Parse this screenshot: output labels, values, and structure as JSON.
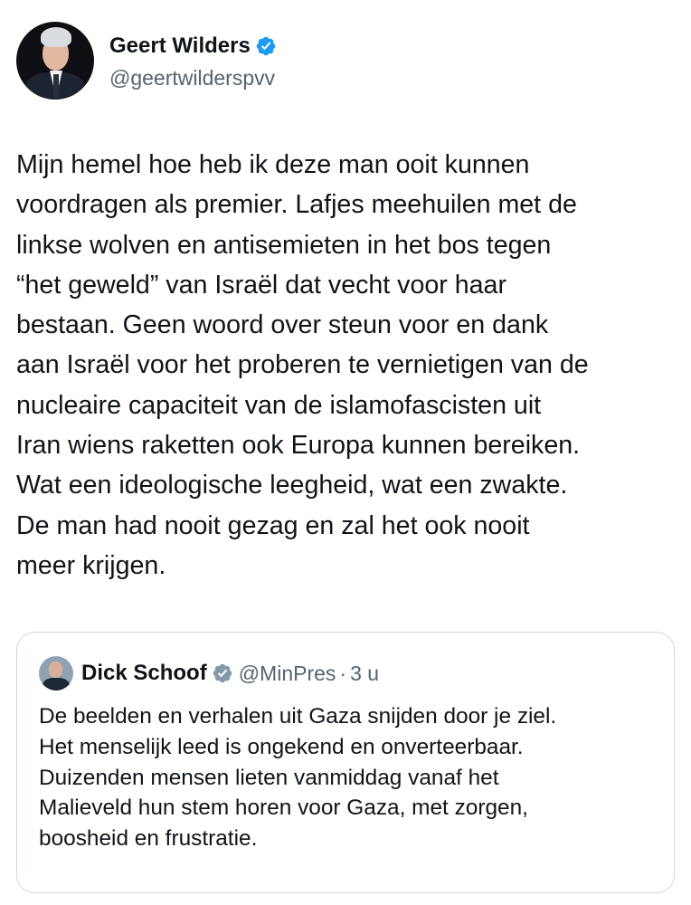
{
  "author": {
    "display_name": "Geert Wilders",
    "handle": "@geertwilderspvv",
    "verified_badge_icon": "verified-badge-icon",
    "badge_color": "#1d9bf0"
  },
  "tweet": {
    "lines": [
      "Mijn hemel hoe heb ik deze man ooit kunnen",
      "voordragen als premier. Lafjes meehuilen met de",
      "linkse wolven en antisemieten in het bos tegen",
      "“het geweld” van Israël dat vecht voor haar",
      "bestaan. Geen woord over steun voor en dank",
      "aan Israël voor het proberen te vernietigen van de",
      "nucleaire capaciteit van de islamofascisten uit",
      "Iran wiens raketten ook Europa kunnen bereiken.",
      "Wat een ideologische leegheid, wat een zwakte.",
      "De man had nooit gezag en zal het ook nooit",
      "meer krijgen."
    ]
  },
  "quoted_tweet": {
    "display_name": "Dick Schoof",
    "handle": "@MinPres",
    "separator": "·",
    "time": "3 u",
    "lines": [
      "De beelden en verhalen uit Gaza snijden door je ziel.",
      "Het menselijk leed is ongekend en onverteerbaar.",
      "Duizenden mensen lieten vanmiddag vanaf het",
      "Malieveld hun stem horen voor Gaza, met zorgen,",
      "boosheid en frustratie."
    ]
  },
  "colors": {
    "text_primary": "#0f1419",
    "text_secondary": "#536471",
    "border": "#cfd9de",
    "badge_government": "#829aab"
  }
}
